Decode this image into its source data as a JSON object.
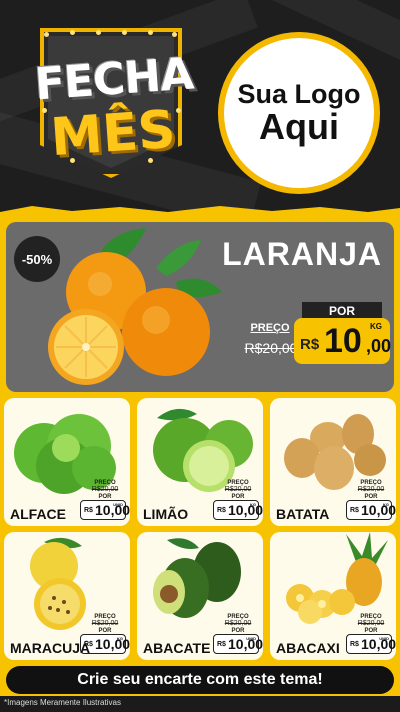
{
  "header": {
    "badge_line1": "FECHA",
    "badge_line2": "MÊS",
    "logo_line1": "Sua Logo",
    "logo_line2": "Aqui"
  },
  "featured": {
    "discount": "-50%",
    "name": "LARANJA",
    "old_label": "PREÇO",
    "old_price": "R$20,00",
    "por_label": "POR",
    "currency": "R$",
    "price_main": "10",
    "price_cents": ",00",
    "unit": "KG"
  },
  "products": [
    {
      "name": "ALFACE",
      "old_label": "PREÇO",
      "old_price": "R$20,00",
      "por": "POR",
      "currency": "R$",
      "price": "10,00",
      "unit": "UNID"
    },
    {
      "name": "LIMÃO",
      "old_label": "PREÇO",
      "old_price": "R$20,00",
      "por": "POR",
      "currency": "R$",
      "price": "10,00",
      "unit": "KG"
    },
    {
      "name": "BATATA",
      "old_label": "PREÇO",
      "old_price": "R$20,00",
      "por": "POR",
      "currency": "R$",
      "price": "10,00",
      "unit": "KG"
    },
    {
      "name": "MARACUJÁ",
      "old_label": "PREÇO",
      "old_price": "R$20,00",
      "por": "POR",
      "currency": "R$",
      "price": "10,00",
      "unit": "KG"
    },
    {
      "name": "ABACATE",
      "old_label": "PREÇO",
      "old_price": "R$20,00",
      "por": "POR",
      "currency": "R$",
      "price": "10,00",
      "unit": "UNID"
    },
    {
      "name": "ABACAXI",
      "old_label": "PREÇO",
      "old_price": "R$20,00",
      "por": "POR",
      "currency": "R$",
      "price": "10,00",
      "unit": "UNID"
    }
  ],
  "cta": "Crie seu encarte com este tema!",
  "footnote": "*Imagens Meramente Ilustrativas",
  "colors": {
    "accent": "#f7c300",
    "dark": "#1e1e1e",
    "card": "#fffbea",
    "featured_bg": "#6b6b6b"
  }
}
